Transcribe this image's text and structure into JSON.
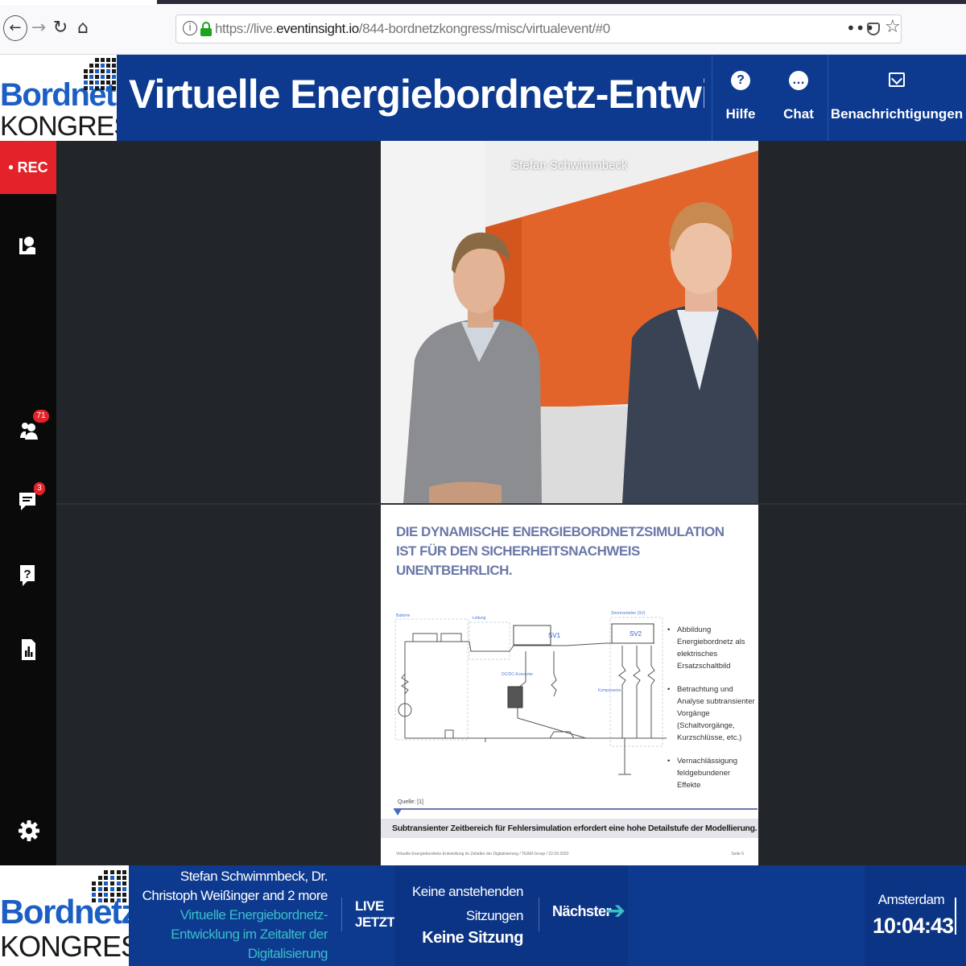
{
  "browser": {
    "url_prefix": "https://live.",
    "url_domain": "eventinsight.io",
    "url_path": "/844-bordnetzkongress/misc/virtualevent/#0",
    "more_glyph": "•••"
  },
  "brand": {
    "logo_word1": "Bordnetz",
    "logo_word2": "KONGRESS",
    "colors": {
      "primary": "#0d3a8f",
      "accent": "#3bbfc7",
      "logo_blue": "#1c5fc4",
      "rec_red": "#e3222a"
    }
  },
  "header": {
    "title": "Virtuelle Energiebordnetz-Entwicklu...",
    "buttons": [
      {
        "label": "Hilfe",
        "icon": "question-circle-icon"
      },
      {
        "label": "Chat",
        "icon": "chat-bubble-icon"
      },
      {
        "label": "Benachrichtigungen",
        "icon": "mail-icon"
      }
    ]
  },
  "sidebar": {
    "rec_label": "• REC",
    "items": [
      {
        "icon": "presenter-icon"
      },
      {
        "icon": "attendees-icon",
        "badge": "71"
      },
      {
        "icon": "chat-icon",
        "badge": "3"
      },
      {
        "icon": "question-icon"
      },
      {
        "icon": "poll-chart-icon"
      },
      {
        "icon": "settings-gear-icon"
      }
    ]
  },
  "video": {
    "speaker_name": "Stefan Schwimmbeck"
  },
  "slide": {
    "title": "Die dynamische Energiebordnetzsimulation ist für den Sicherheitsnachweis unentbehrlich.",
    "bullets": [
      "Abbildung Energiebordnetz als elektrisches Ersatzschaltbild",
      "Betrachtung und Analyse subtransienter Vorgänge (Schaltvorgänge, Kurzschlüsse, etc.)",
      "Vernachlässigung feldgebundener Effekte"
    ],
    "diagram_labels": {
      "battery": "Batterie",
      "wiring": "Leitung",
      "dcdc": "DC/DC-Konverter",
      "distributor": "Stromverteiler (SV)",
      "components": "Komponente",
      "sv1": "SV1",
      "sv2": "SV2"
    },
    "source": "Quelle: [1]",
    "caption": "Subtransienter Zeitbereich für Fehlersimulation erfordert eine hohe Detailstufe der Modellierung.",
    "footer": "Virtuelle Energiebordnetz-Entwicklung im Zeitalter der Digitalisierung / TEAM Group / 22.09.2020",
    "page": "Seite 6"
  },
  "bottom": {
    "speakers": "Stefan Schwimmbeck, Dr. Christoph Weißinger and 2 more",
    "session": "Virtuelle Energiebordnetz-Entwicklung im Zeitalter der Digitalisierung",
    "live_label": "LIVE JETZT",
    "no_upcoming": "Keine anstehenden Sitzungen",
    "no_session": "Keine Sitzung",
    "next_label": "Nächster",
    "next_arrow": "➔",
    "city": "Amsterdam",
    "time": "10:04:43"
  }
}
